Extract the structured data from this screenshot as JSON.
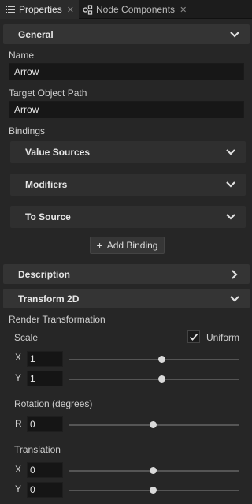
{
  "tabs": [
    {
      "label": "Properties",
      "icon": "list-icon",
      "active": true
    },
    {
      "label": "Node Components",
      "icon": "node-components-icon",
      "active": false
    }
  ],
  "general": {
    "header": "General",
    "name_label": "Name",
    "name_value": "Arrow",
    "target_path_label": "Target Object Path",
    "target_path_value": "Arrow",
    "bindings_label": "Bindings",
    "value_sources": "Value Sources",
    "modifiers": "Modifiers",
    "to_source": "To Source",
    "add_binding": "Add Binding"
  },
  "description": {
    "header": "Description"
  },
  "transform": {
    "header": "Transform 2D",
    "render_transformation": "Render Transformation",
    "scale_label": "Scale",
    "uniform_label": "Uniform",
    "uniform_checked": true,
    "scale_x_label": "X",
    "scale_x": "1",
    "scale_y_label": "Y",
    "scale_y": "1",
    "rotation_label": "Rotation (degrees)",
    "rotation_r_label": "R",
    "rotation": "0",
    "translation_label": "Translation",
    "translation_x_label": "X",
    "translation_x": "0",
    "translation_y_label": "Y",
    "translation_y": "0"
  },
  "colors": {
    "background": "#262626",
    "header": "#343434",
    "field": "#171717"
  }
}
